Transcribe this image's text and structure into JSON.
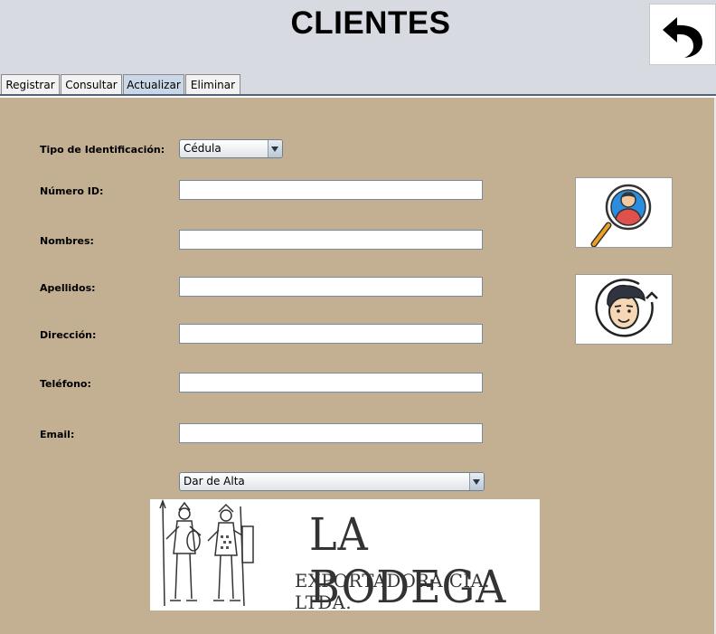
{
  "header": {
    "title": "CLIENTES"
  },
  "back_button": {
    "icon": "back-arrow-icon"
  },
  "tabs": [
    {
      "label": "Registrar",
      "active": false
    },
    {
      "label": "Consultar",
      "active": false
    },
    {
      "label": "Actualizar",
      "active": true
    },
    {
      "label": "Eliminar",
      "active": false
    }
  ],
  "form": {
    "tipo_id_label": "Tipo de Identificación:",
    "tipo_id_value": "Cédula",
    "numero_id_label": "Número ID:",
    "numero_id_value": "",
    "nombres_label": "Nombres:",
    "nombres_value": "",
    "apellidos_label": "Apellidos:",
    "apellidos_value": "",
    "direccion_label": "Dirección:",
    "direccion_value": "",
    "telefono_label": "Teléfono:",
    "telefono_value": "",
    "email_label": "Email:",
    "email_value": "",
    "estado_value": "Dar de Alta"
  },
  "buttons": {
    "search_icon": "search-user-icon",
    "refresh_icon": "refresh-user-icon"
  },
  "logo": {
    "title": "LA BODEGA",
    "subtitle": "EXPORTADORA CÍA. LTDA."
  },
  "colors": {
    "panel_bg": "#c3b093",
    "header_bg": "#d8dae1",
    "active_tab": "#c9d7e6"
  }
}
